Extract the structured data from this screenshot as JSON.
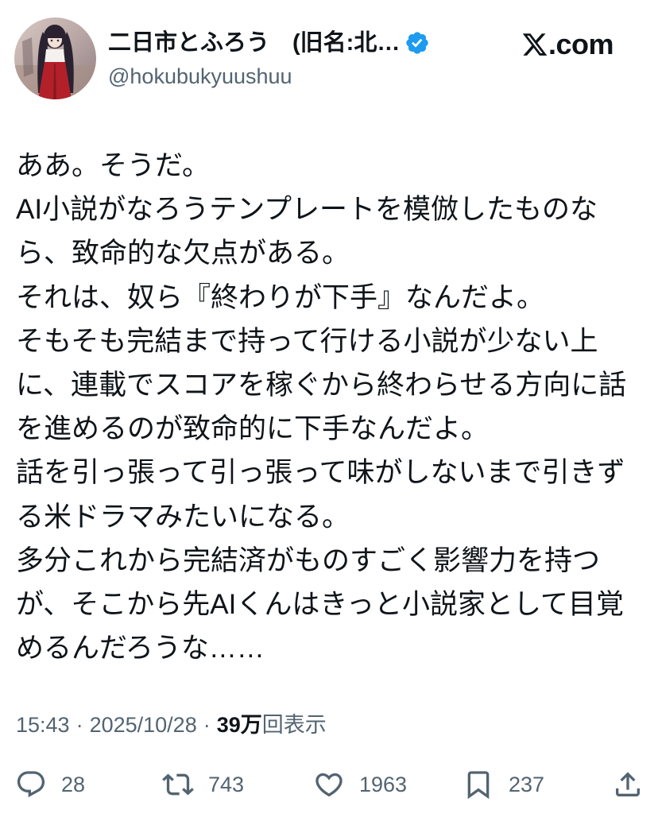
{
  "header": {
    "display_name": "二日市とふろう　(旧名:北…",
    "handle": "@hokubukyuushuu",
    "verified_icon": "verified-badge-icon",
    "site_logo_icon": "x-logo-icon",
    "site_suffix": ".com"
  },
  "tweet": {
    "lines": [
      "ああ。そうだ。",
      "AI小説がなろうテンプレートを模倣したものな",
      "ら、致命的な欠点がある。",
      "それは、奴ら『終わりが下手』なんだよ。",
      "そもそも完結まで持って行ける小説が少ない上",
      "に、連載でスコアを稼ぐから終わらせる方向に話",
      "を進めるのが致命的に下手なんだよ。",
      "話を引っ張って引っ張って味がしないまで引きず",
      "る米ドラマみたいになる。",
      "多分これから完結済がものすごく影響力を持つ",
      "が、そこから先AIくんはきっと小説家として目覚",
      "めるんだろうな……"
    ]
  },
  "meta": {
    "time": "15:43",
    "separator": "·",
    "date": "2025/10/28",
    "views_count": "39万",
    "views_label": "回表示"
  },
  "actions": {
    "reply": {
      "icon": "reply-icon",
      "count": "28"
    },
    "repost": {
      "icon": "repost-icon",
      "count": "743"
    },
    "like": {
      "icon": "heart-icon",
      "count": "1963"
    },
    "bookmark": {
      "icon": "bookmark-icon",
      "count": "237"
    },
    "share": {
      "icon": "share-icon"
    }
  },
  "colors": {
    "text": "#0f1419",
    "muted": "#536471",
    "verified": "#1d9bf0",
    "background": "#ffffff"
  }
}
